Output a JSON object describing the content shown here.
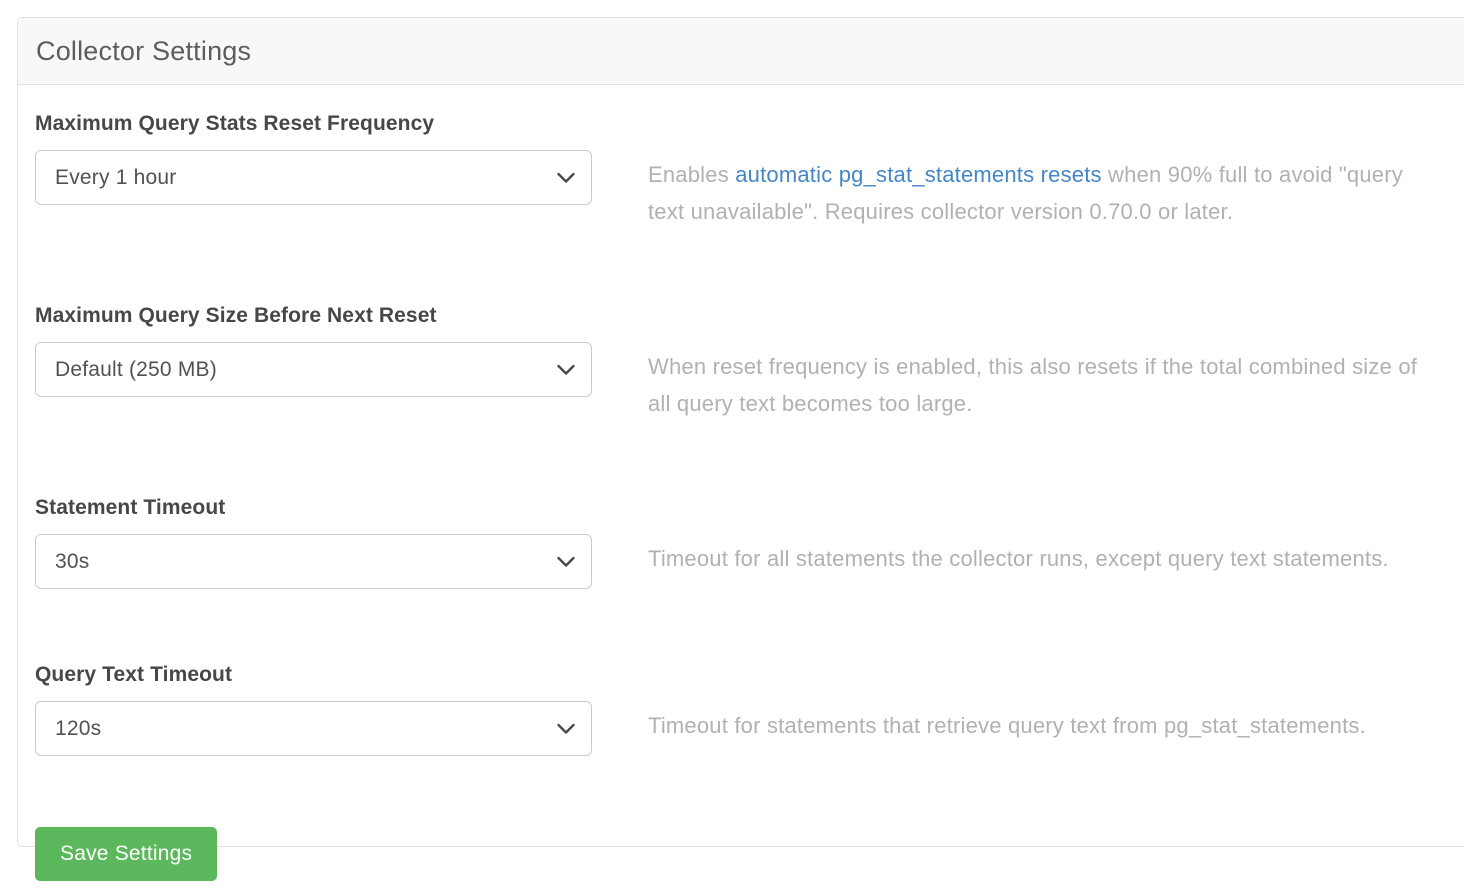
{
  "panel": {
    "title": "Collector Settings"
  },
  "fields": [
    {
      "label": "Maximum Query Stats Reset Frequency",
      "value": "Every 1 hour",
      "desc": {
        "before": "Enables ",
        "link": "automatic pg_stat_statements resets",
        "after": " when 90% full to avoid \"query text unavailable\". Requires collector version 0.70.0 or later."
      }
    },
    {
      "label": "Maximum Query Size Before Next Reset",
      "value": "Default (250 MB)",
      "desc": {
        "before": "When reset frequency is enabled, this also resets if the total combined size of all query text becomes too large.",
        "link": "",
        "after": ""
      }
    },
    {
      "label": "Statement Timeout",
      "value": "30s",
      "desc": {
        "before": "Timeout for all statements the collector runs, except query text statements.",
        "link": "",
        "after": ""
      }
    },
    {
      "label": "Query Text Timeout",
      "value": "120s",
      "desc": {
        "before": "Timeout for statements that retrieve query text from pg_stat_statements.",
        "link": "",
        "after": ""
      }
    }
  ],
  "actions": {
    "save_label": "Save Settings"
  },
  "icons": {
    "select_chevron": "chevron-down-icon"
  },
  "colors": {
    "save_button_bg": "#5cb85c",
    "link_blue": "#4486c6",
    "header_bg": "#f8f8fa",
    "label_text": "#474747",
    "description_text": "#b1b1b5",
    "select_border": "#cbcbcf",
    "title_text": "#5d5d61"
  }
}
